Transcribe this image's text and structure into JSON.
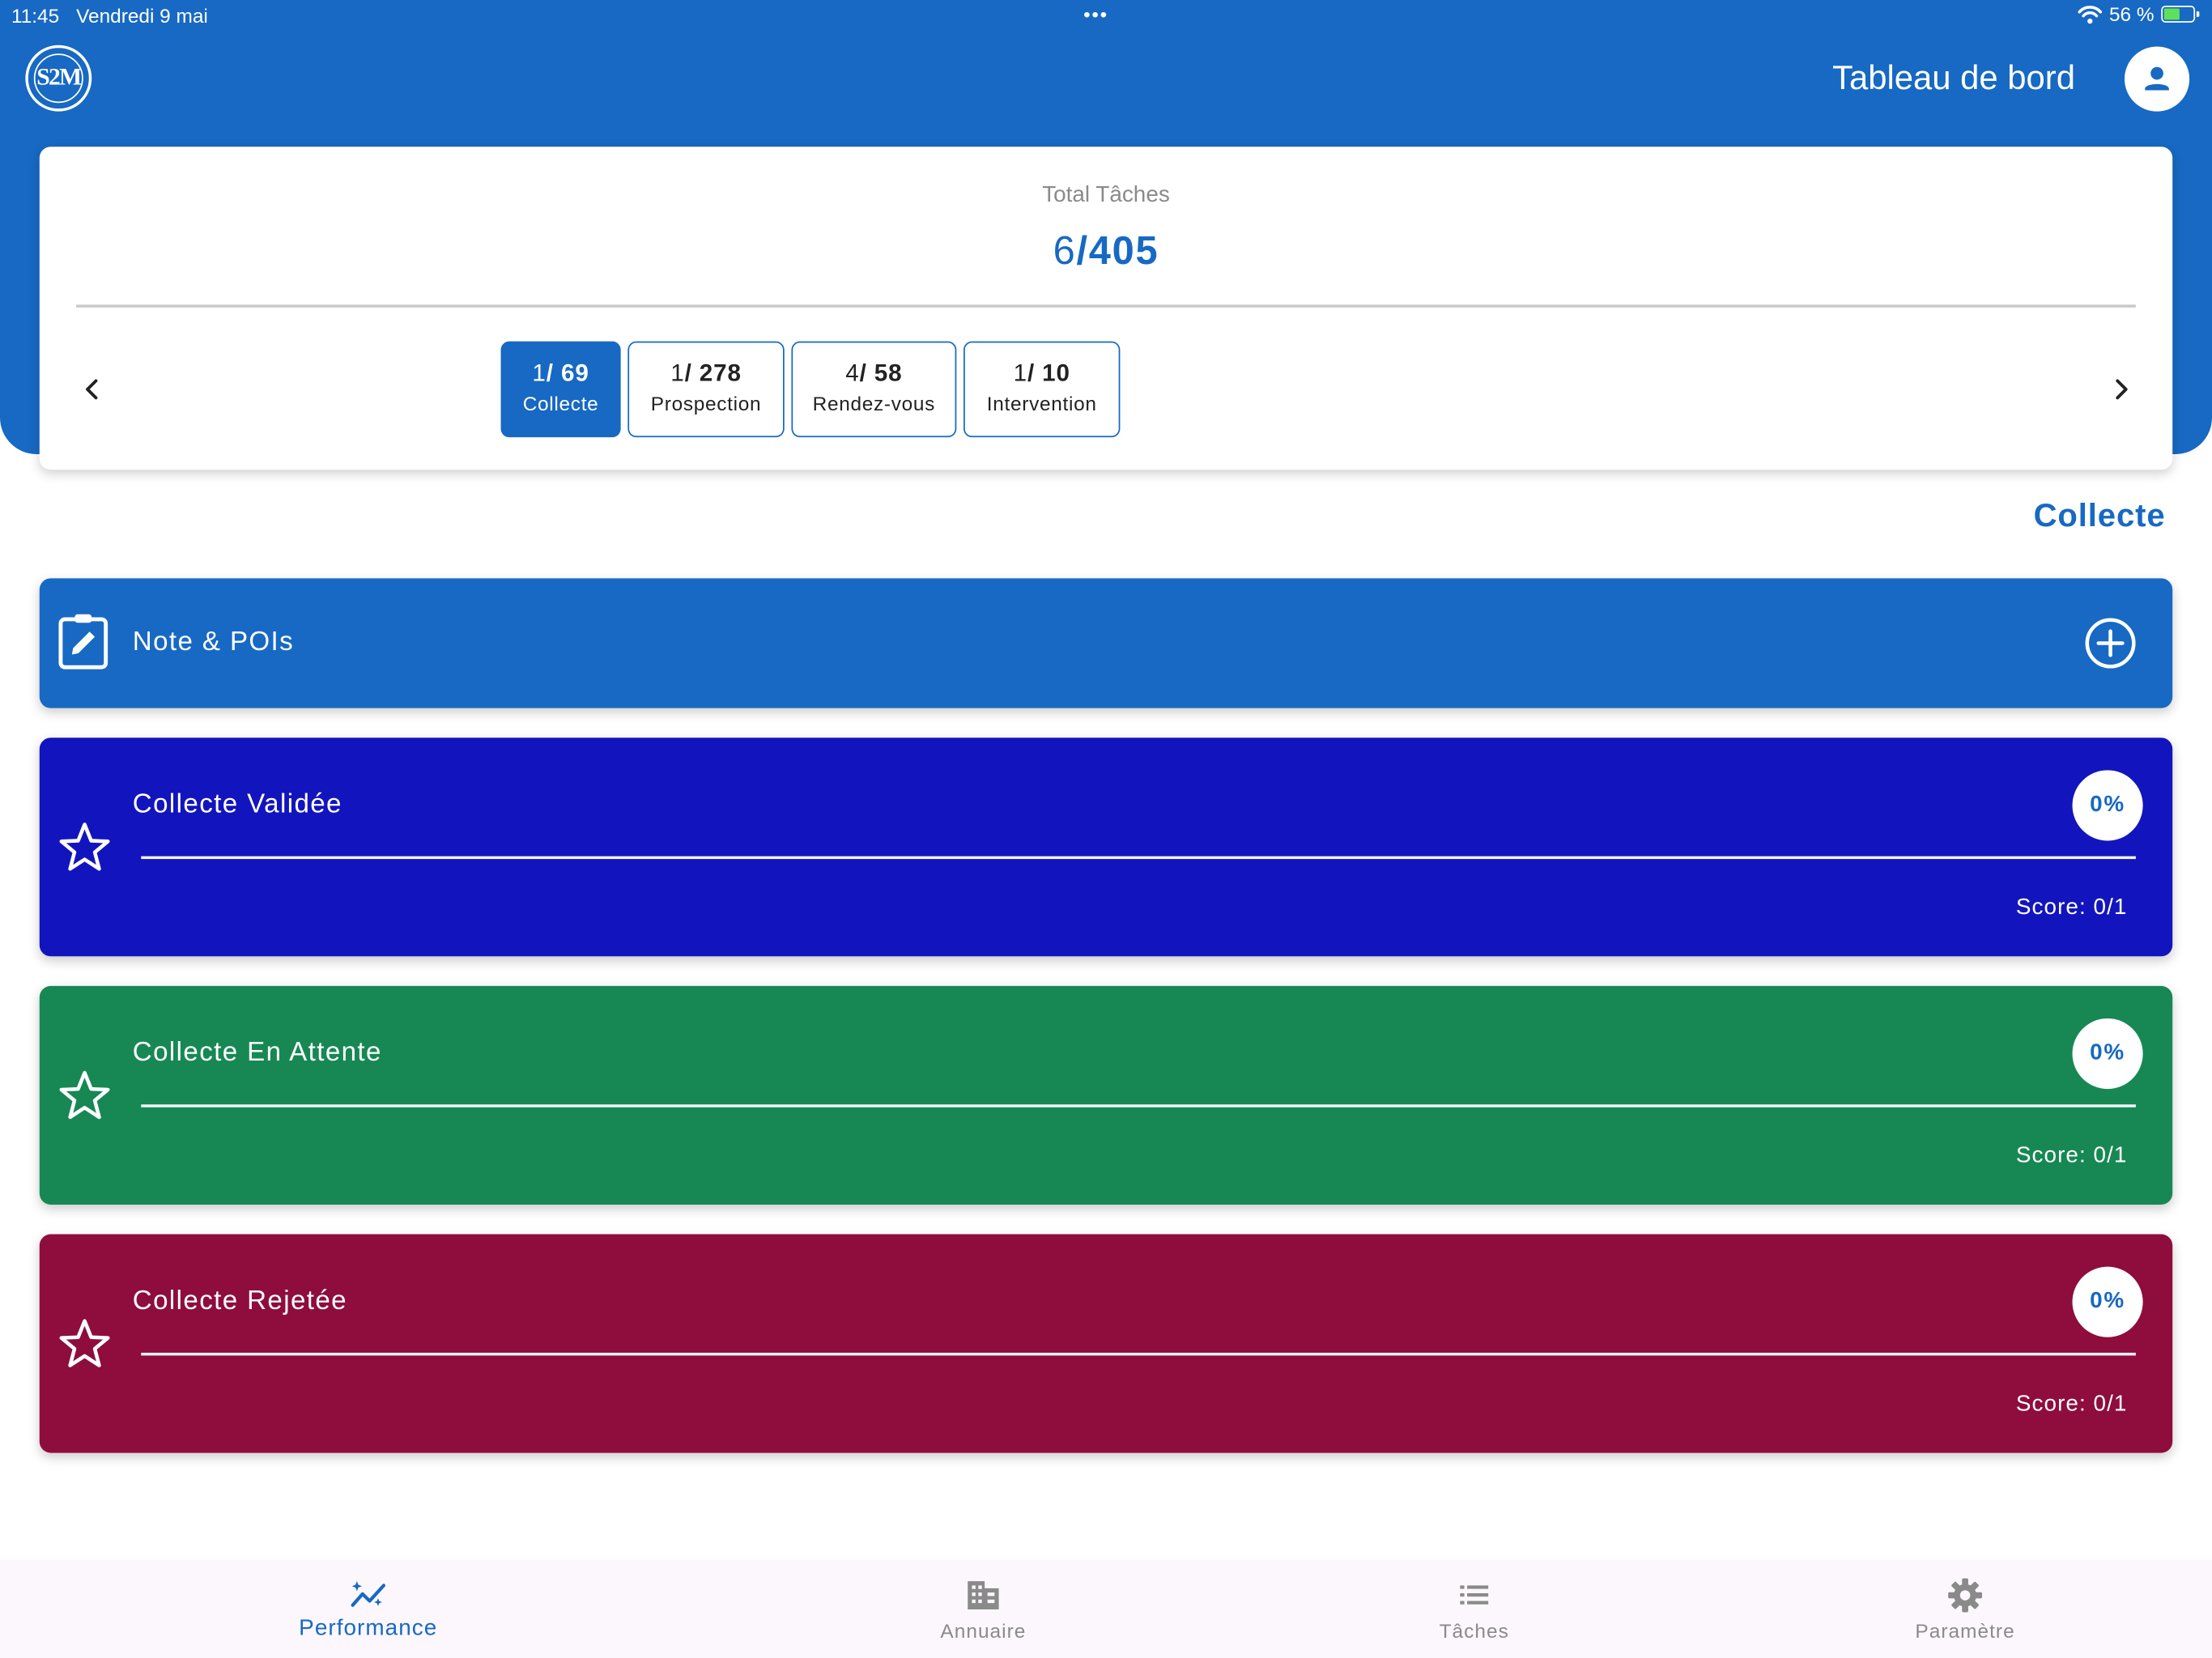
{
  "status_bar": {
    "time": "11:45",
    "date": "Vendredi 9 mai",
    "dots": "•••",
    "battery": "56 %",
    "battery_level_pct": 56
  },
  "header": {
    "logo_text": "S2M",
    "title": "Tableau de bord"
  },
  "summary": {
    "label": "Total Tâches",
    "done": "6",
    "total": "/405",
    "categories": [
      {
        "done": "1",
        "total": "/ 69",
        "name": "Collecte",
        "active": true
      },
      {
        "done": "1",
        "total": "/ 278",
        "name": "Prospection",
        "active": false
      },
      {
        "done": "4",
        "total": "/ 58",
        "name": "Rendez-vous",
        "active": false
      },
      {
        "done": "1",
        "total": "/ 10",
        "name": "Intervention",
        "active": false
      }
    ]
  },
  "section_title": "Collecte",
  "note": {
    "label": "Note & POIs"
  },
  "cards": [
    {
      "title": "Collecte Validée",
      "percent": "0%",
      "score": "Score: 0/1",
      "color": "#1215bd"
    },
    {
      "title": "Collecte En Attente",
      "percent": "0%",
      "score": "Score: 0/1",
      "color": "#178854"
    },
    {
      "title": "Collecte Rejetée",
      "percent": "0%",
      "score": "Score: 0/1",
      "color": "#8e0d3d"
    }
  ],
  "bottom_nav": [
    {
      "label": "Performance",
      "icon": "performance-icon",
      "active": true
    },
    {
      "label": "Annuaire",
      "icon": "building-icon",
      "active": false
    },
    {
      "label": "Tâches",
      "icon": "list-icon",
      "active": false
    },
    {
      "label": "Paramètre",
      "icon": "gear-icon",
      "active": false
    }
  ],
  "colors": {
    "primary": "#1769c3",
    "validated": "#1215bd",
    "pending": "#178854",
    "rejected": "#8e0d3d",
    "nav_background": "#fcf7fc"
  }
}
